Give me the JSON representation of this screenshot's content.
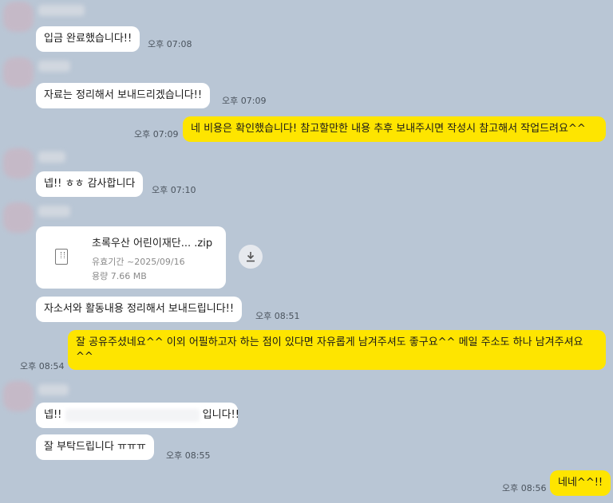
{
  "messages": {
    "m1": {
      "text": "입금 완료했습니다!!",
      "time": "오후 07:08"
    },
    "m2": {
      "text": "자료는 정리해서 보내드리겠습니다!!",
      "time": "오후 07:09"
    },
    "m3": {
      "text": "네 비용은 확인했습니다! 참고할만한 내용 추후 보내주시면 작성시 참고해서 작업드려요^^",
      "time": "오후 07:09"
    },
    "m4": {
      "text": "넵!! ㅎㅎ 감사합니다",
      "time": "오후 07:10"
    },
    "file": {
      "name": "초록우산 어린이재단... .zip",
      "expiry": "유효기간 ~2025/09/16",
      "size": "용량 7.66 MB"
    },
    "m5": {
      "text": "자소서와 활동내용 정리해서 보내드립니다!!",
      "time": "오후 08:51"
    },
    "m6": {
      "text": "잘 공유주셨네요^^ 이외 어필하고자 하는 점이 있다면 자유롭게 남겨주셔도 좋구요^^ 메일 주소도 하나 남겨주셔요 ^^",
      "time": "오후 08:54"
    },
    "m7": {
      "prefix": "넵!!",
      "suffix": "입니다!!"
    },
    "m8": {
      "text": "잘 부탁드립니다 ㅠㅠㅠ",
      "time": "오후 08:55"
    },
    "m9": {
      "text": "네네^^!!",
      "time": "오후 08:56"
    }
  },
  "colors": {
    "background": "#b9c6d5",
    "incoming": "#ffffff",
    "outgoing": "#fee500"
  },
  "icons": {
    "file": "zip-file-icon",
    "download": "download-icon"
  }
}
